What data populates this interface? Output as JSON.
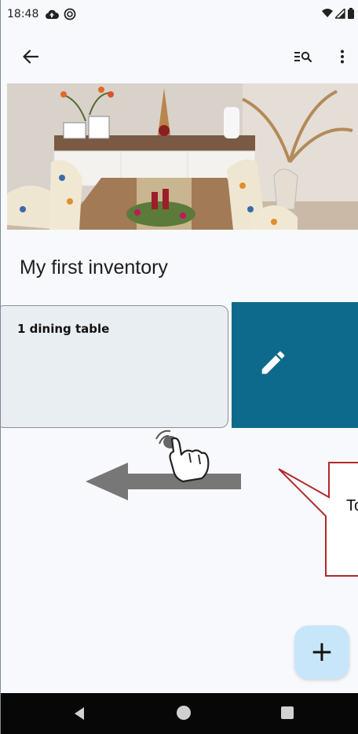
{
  "status_bar": {
    "time": "18:48",
    "left_icons": [
      "cloud-upload-icon",
      "sync-circle-icon"
    ],
    "right_icons": [
      "wifi-icon",
      "cell-signal-icon",
      "battery-icon"
    ]
  },
  "app_bar": {
    "back_icon": "arrow-back-icon",
    "actions": [
      "filter-search-icon",
      "more-vert-icon"
    ]
  },
  "inventory": {
    "title": "My first inventory",
    "items": [
      {
        "number": "1",
        "name": "dining table",
        "label": "1  dining table"
      }
    ]
  },
  "swipe_action": {
    "icon": "pencil-icon",
    "color": "#0e6a8c"
  },
  "tutorial": {
    "callout_text": "To",
    "gesture": "swipe-left",
    "callout_border_color": "#b02a2a"
  },
  "fab": {
    "icon": "plus-icon",
    "label": "+",
    "color": "#c8e6fa"
  },
  "nav_bar": {
    "icons": [
      "back-triangle-icon",
      "home-circle-icon",
      "recents-square-icon"
    ]
  }
}
